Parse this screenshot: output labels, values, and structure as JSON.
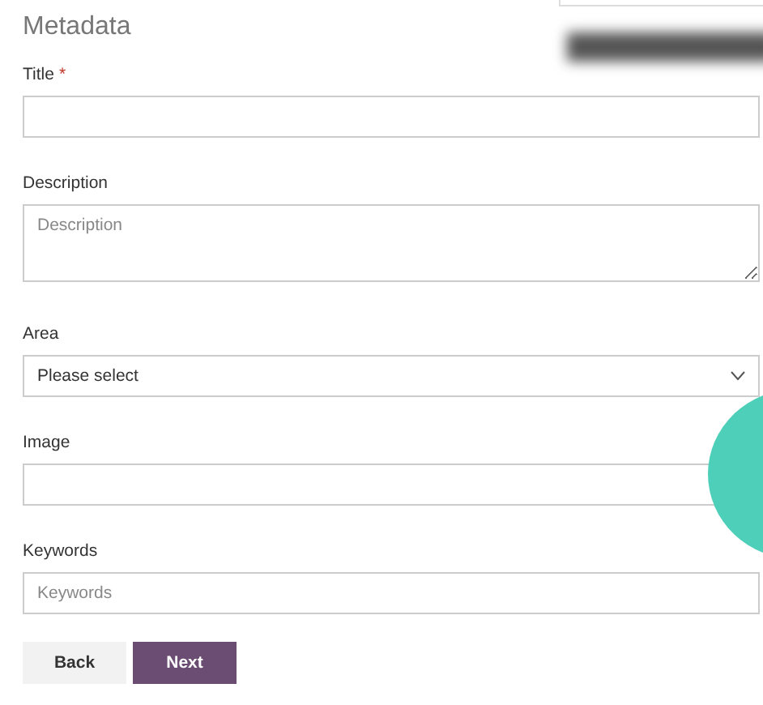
{
  "heading": "Metadata",
  "fields": [
    {
      "kind": "text",
      "label": "Title",
      "required_mark": "*"
    },
    {
      "kind": "textarea",
      "label": "Description",
      "placeholder": "Description"
    },
    {
      "kind": "select",
      "label": "Area",
      "value": "Please select"
    },
    {
      "kind": "text",
      "label": "Image"
    },
    {
      "kind": "text",
      "label": "Keywords",
      "placeholder": "Keywords"
    }
  ],
  "buttons": [
    {
      "label": "Back",
      "kind": "secondary"
    },
    {
      "label": "Next",
      "kind": "primary"
    }
  ]
}
